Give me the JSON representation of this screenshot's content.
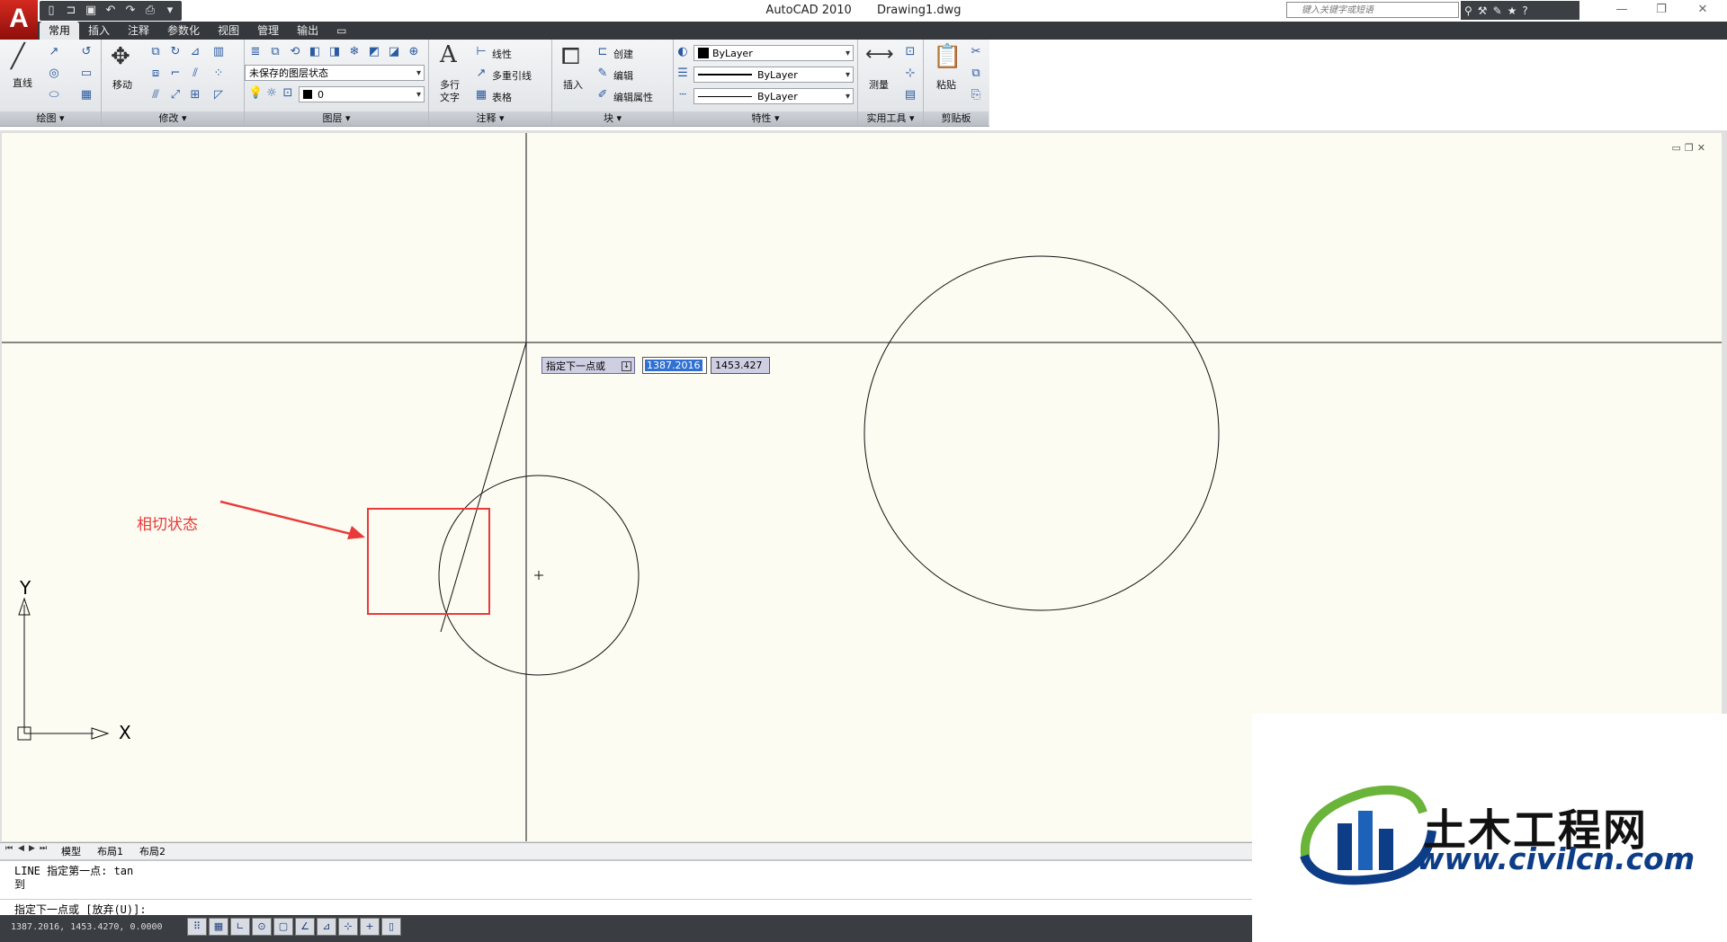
{
  "app": {
    "logo_letter": "A",
    "title": "AutoCAD 2010",
    "filename": "Drawing1.dwg",
    "search_placeholder": "键入关键字或短语"
  },
  "tabs": [
    "常用",
    "插入",
    "注释",
    "参数化",
    "视图",
    "管理",
    "输出"
  ],
  "ribbon": {
    "draw": {
      "title": "绘图",
      "line_label": "直线"
    },
    "modify": {
      "title": "修改",
      "move_label": "移动"
    },
    "layers": {
      "title": "图层",
      "layer_state": "未保存的图层状态",
      "current_layer": "0"
    },
    "annotation": {
      "title": "注释",
      "mtext_label_1": "多行",
      "mtext_label_2": "文字",
      "linear": "线性",
      "mleader": "多重引线",
      "table": "表格"
    },
    "block": {
      "title": "块",
      "insert": "插入",
      "create": "创建",
      "edit": "编辑",
      "edit_attr": "编辑属性"
    },
    "properties": {
      "title": "特性",
      "color": "ByLayer",
      "linetype": "ByLayer",
      "lineweight": "ByLayer"
    },
    "utilities": {
      "title": "实用工具",
      "measure": "测量"
    },
    "clipboard": {
      "title": "剪贴板",
      "paste": "粘贴"
    }
  },
  "canvas": {
    "prompt_label": "指定下一点或",
    "input_x": "1387.2016",
    "input_y": "1453.427",
    "annotation_text": "相切状态",
    "ucs_x": "X",
    "ucs_y": "Y"
  },
  "layout_tabs": [
    "模型",
    "布局1",
    "布局2"
  ],
  "command_line": {
    "line1": "LINE 指定第一点: tan",
    "line2": "到",
    "line3": "指定下一点或 [放弃(U)]:"
  },
  "status": {
    "coords": "1387.2016, 1453.4270, 0.0000"
  },
  "watermark": {
    "cn": "土木工程网",
    "url": "www.civilcn.com"
  },
  "colors": {
    "annotation_red": "#e83a3a",
    "canvas_bg": "#fcfcf2"
  }
}
